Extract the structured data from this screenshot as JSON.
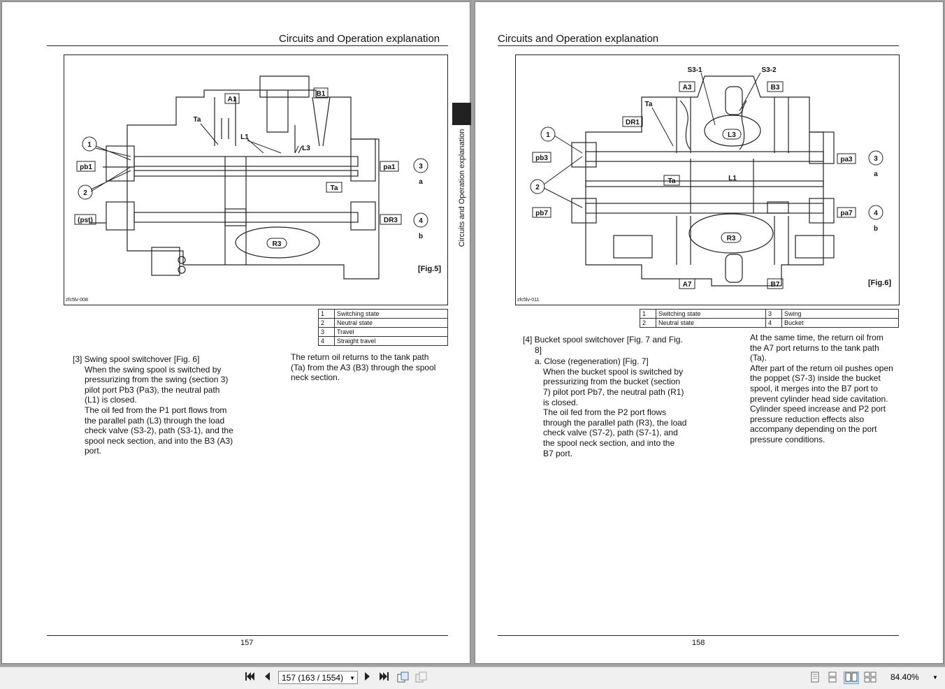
{
  "left_page": {
    "header": "Circuits and Operation explanation",
    "figure_id": "zfc5lv-008",
    "figure_label": "[Fig.5]",
    "diagram_labels": {
      "a1": "A1",
      "b1": "B1",
      "ta1": "Ta",
      "ta2": "Ta",
      "l1": "L1",
      "l3": "L3",
      "pb1": "pb1",
      "pa1": "pa1",
      "pst": "(pst)",
      "dr3": "DR3",
      "r3": "R3",
      "c1": "1",
      "c2": "2",
      "c3": "3",
      "c4": "4",
      "a": "a",
      "b": "b"
    },
    "legend": [
      [
        "1",
        "Switching state"
      ],
      [
        "2",
        "Neutral state"
      ],
      [
        "3",
        "Travel"
      ],
      [
        "4",
        "Straight travel"
      ]
    ],
    "col1": {
      "heading": "[3] Swing spool switchover [Fig. 6]",
      "lines": [
        "When the swing spool is switched by",
        "pressurizing from the swing (section 3)",
        "pilot port Pb3 (Pa3), the neutral path",
        "(L1) is closed.",
        "The oil fed from the P1 port flows from",
        "the parallel path (L3) through the load",
        "check valve (S3-2), path (S3-1), and the",
        "spool neck section, and into the B3 (A3)",
        "port."
      ]
    },
    "col2": {
      "lines": [
        "The return oil returns to the tank path",
        "(Ta) from the A3 (B3) through the spool",
        "neck section."
      ]
    },
    "side_text": "Circuits and Operation explanation",
    "page_number": "157"
  },
  "right_page": {
    "header": "Circuits and Operation explanation",
    "figure_id": "zfc5lv-011",
    "figure_label": "[Fig.6]",
    "diagram_labels": {
      "s31": "S3-1",
      "s32": "S3-2",
      "a3": "A3",
      "b3": "B3",
      "ta1": "Ta",
      "ta2": "Ta",
      "dr1": "DR1",
      "l3": "L3",
      "l1": "L1",
      "pb3": "pb3",
      "pa3": "pa3",
      "pb7": "pb7",
      "pa7": "pa7",
      "r3": "R3",
      "a7": "A7",
      "b7": "B7",
      "c1": "1",
      "c2": "2",
      "c3": "3",
      "c4": "4",
      "a": "a",
      "b": "b"
    },
    "legend": [
      [
        "1",
        "Switching state",
        "3",
        "Swing"
      ],
      [
        "2",
        "Neutral state",
        "4",
        "Bucket"
      ]
    ],
    "col1": {
      "heading": "[4] Bucket spool switchover [Fig. 7 and Fig.",
      "heading2": "8]",
      "sub": "a. Close (regeneration) [Fig. 7]",
      "lines": [
        "When the bucket spool is switched by",
        "pressurizing from the bucket (section",
        "7) pilot port Pb7, the neutral path (R1)",
        "is closed.",
        "The oil fed from the P2 port flows",
        "through the parallel path (R3), the load",
        "check valve (S7-2), path (S7-1), and",
        "the spool neck section, and into the",
        "B7 port."
      ]
    },
    "col2": {
      "lines": [
        "At the same time, the return oil from",
        "the A7 port returns to the tank path",
        "(Ta).",
        "After part of the return oil pushes open",
        "the poppet (S7-3) inside the bucket",
        "spool, it merges into the B7 port to",
        "prevent cylinder head side cavitation.",
        "Cylinder speed increase and P2 port",
        "pressure reduction effects also",
        "accompany depending on the port",
        "pressure conditions."
      ]
    },
    "page_number": "158"
  },
  "toolbar": {
    "first_icon": "first-page-icon",
    "prev_icon": "prev-page-icon",
    "next_icon": "next-page-icon",
    "last_icon": "last-page-icon",
    "page_field": "157 (163 / 1554)",
    "zoom": "84.40%"
  }
}
